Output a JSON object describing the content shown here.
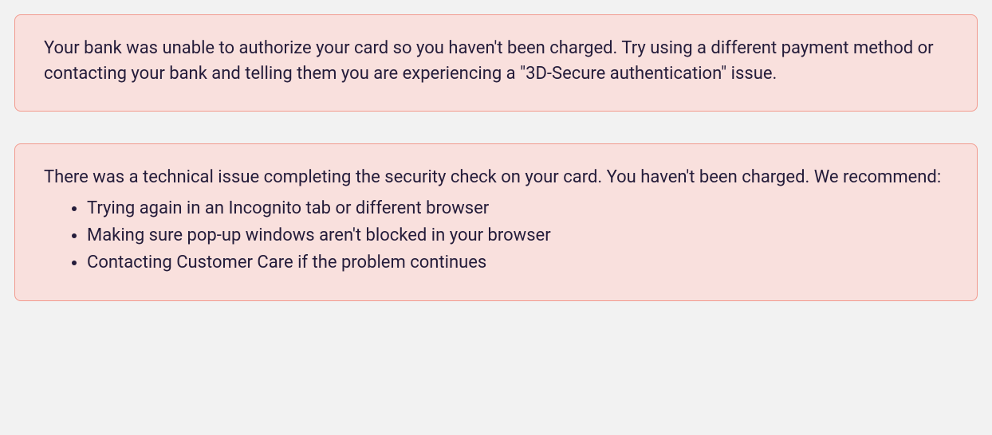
{
  "alerts": [
    {
      "message": "Your bank was unable to authorize your card so you haven't been charged. Try using a different payment method or contacting your bank and telling them you are experiencing a \"3D-Secure authentication\" issue."
    },
    {
      "message": "There was a technical issue completing the security check on your card. You haven't been charged. We recommend:",
      "items": [
        "Trying again in an Incognito tab or different browser",
        "Making sure pop-up windows aren't blocked in your browser",
        "Contacting Customer Care if the problem continues"
      ]
    }
  ]
}
